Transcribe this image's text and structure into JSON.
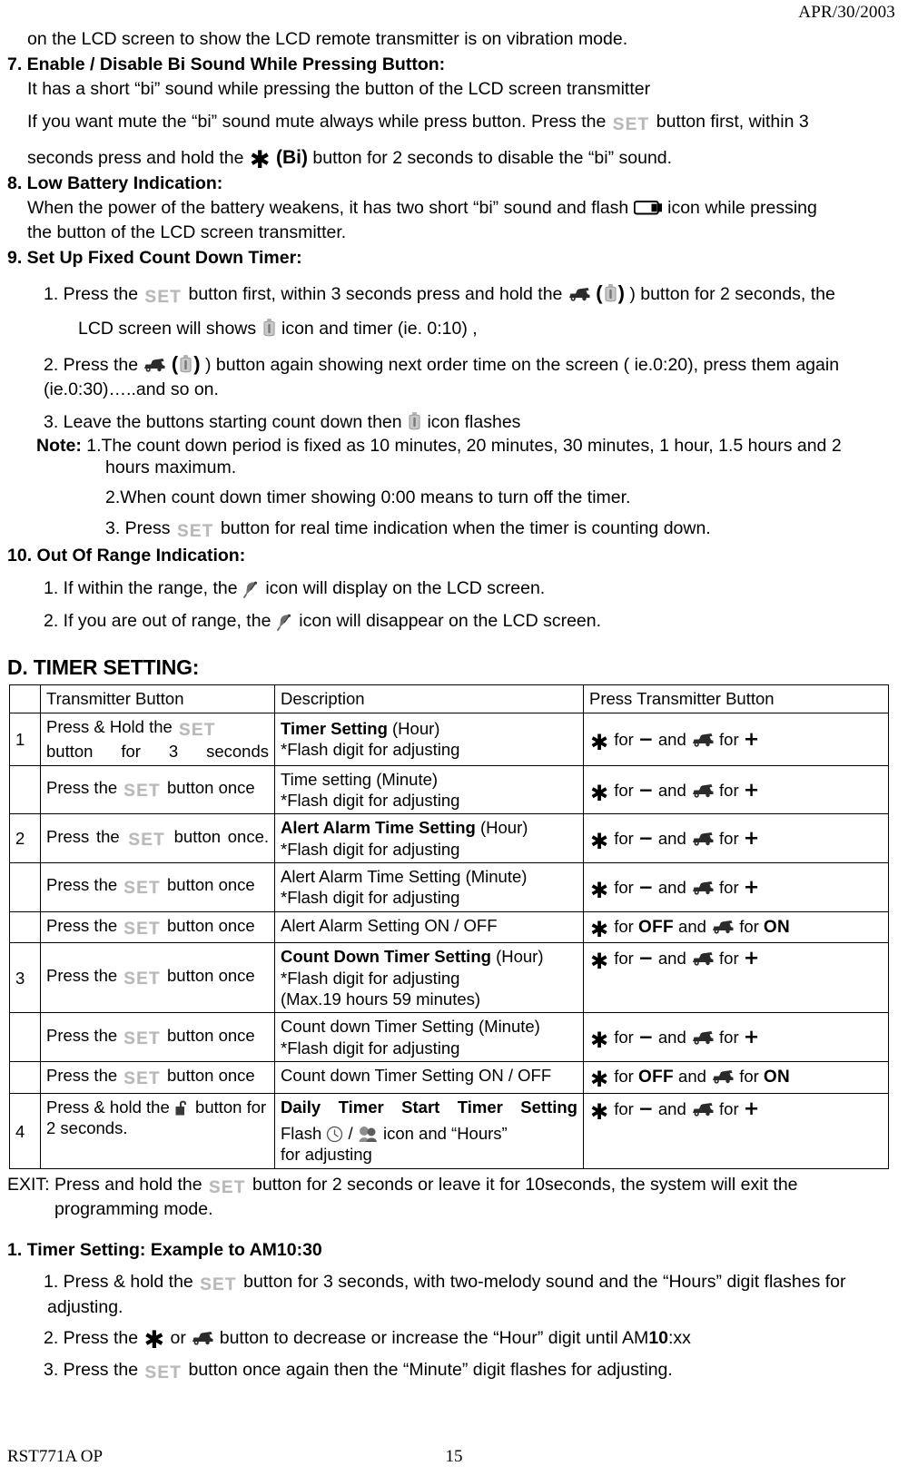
{
  "header": {
    "date": "APR/30/2003"
  },
  "content": {
    "vibration_line": "on the LCD screen to show the LCD remote transmitter is on vibration mode.",
    "s7": {
      "heading": "7. Enable / Disable Bi Sound While Pressing Button:",
      "line1": "It has a short “bi” sound while pressing the button of the LCD screen transmitter",
      "line2_a": "If you want mute the “bi” sound mute always while press button. Press the",
      "line2_b": "button first, within 3",
      "line3_a": "seconds press and hold the",
      "line3_bi": "(Bi)",
      "line3_b": "button for 2 seconds to disable the “bi” sound."
    },
    "s8": {
      "heading": "8. Low Battery Indication:",
      "line1_a": "When the power of the battery weakens, it has two short “bi” sound and flash",
      "line1_b": "icon while pressing",
      "line2": "the button of the LCD screen transmitter."
    },
    "s9": {
      "heading": "9. Set Up Fixed Count Down Timer:",
      "item1_a": "1. Press the",
      "item1_b": "button first, within 3 seconds press and hold the",
      "item1_c": "(",
      "item1_d": ") button for 2 seconds, the",
      "item1_e": "LCD screen will shows",
      "item1_f": "icon and timer (ie. 0:10) ,",
      "item2_a": "2. Press the",
      "item2_b": "(",
      "item2_c": ") button again showing next order time on the screen ( ie.0:20), press them again",
      "item2_d": "(ie.0:30)…..and so on.",
      "item3_a": "3. Leave the buttons starting count down then",
      "item3_b": "icon flashes",
      "note_label": "Note:",
      "note1": "1.The count down period is fixed as 10 minutes, 20 minutes, 30 minutes, 1 hour, 1.5 hours and 2",
      "note1_cont": "hours maximum.",
      "note2": "2.When count down timer showing 0:00 means to turn off the timer.",
      "note3_a": "3. Press",
      "note3_b": "button for real time indication when the timer is counting down."
    },
    "s10": {
      "heading": "10. Out Of Range Indication:",
      "item1_a": "1. If within the range, the",
      "item1_b": "icon will display on the LCD screen.",
      "item2_a": "2. If you are out of range, the",
      "item2_b": "icon will disappear on the LCD screen."
    },
    "section_d": {
      "title": "D. TIMER SETTING:"
    },
    "exit": {
      "line1_a": "EXIT: Press and hold the",
      "line1_b": "button for 2 seconds or leave it for 10seconds, the system will exit the",
      "line2": "programming mode."
    },
    "example": {
      "heading": "1. Timer Setting: Example to AM10:30",
      "step1_a": "1. Press & hold the",
      "step1_b": "button for 3 seconds, with two-melody sound and the “Hours” digit flashes for",
      "step1_c": "adjusting.",
      "step2_a": "2. Press the",
      "step2_or": "or",
      "step2_b": "button to decrease or increase the “Hour” digit until AM",
      "step2_bold": "10",
      "step2_c": ":xx",
      "step3_a": "3. Press the",
      "step3_b": "button once again then the “Minute” digit flashes for adjusting."
    }
  },
  "table": {
    "headers": {
      "num": "",
      "transmitter_button": "Transmitter Button",
      "description": "Description",
      "press_transmitter_button": "Press Transmitter Button"
    },
    "rows": [
      {
        "num": "1",
        "btn_pre": "Press & Hold the",
        "btn_post": "button for 3 seconds",
        "desc_bold": "Timer Setting",
        "desc_plain": " (Hour)",
        "desc_line2": "*Flash digit for adjusting",
        "desc_line3": "",
        "press_type": "plusminus",
        "press_for1": "for",
        "press_minus": "−",
        "press_and": "and",
        "press_for2": "for",
        "press_plus": "+"
      },
      {
        "num": "",
        "btn_pre": "Press the",
        "btn_post": "button once",
        "desc_bold": "",
        "desc_plain": "Time setting (Minute)",
        "desc_line2": "*Flash digit for adjusting",
        "desc_line3": "",
        "press_type": "plusminus",
        "press_for1": "for",
        "press_minus": "−",
        "press_and": "and",
        "press_for2": "for",
        "press_plus": "+"
      },
      {
        "num": "2",
        "btn_pre": "Press the",
        "btn_post": "button once.",
        "desc_bold": "Alert Alarm Time Setting",
        "desc_plain": " (Hour)",
        "desc_line2": "*Flash digit for adjusting",
        "desc_line3": "",
        "press_type": "plusminus",
        "press_for1": "for",
        "press_minus": "−",
        "press_and": "and",
        "press_for2": "for",
        "press_plus": "+"
      },
      {
        "num": "",
        "btn_pre": "Press the",
        "btn_post": "button once",
        "desc_bold": "",
        "desc_plain": "Alert Alarm Time Setting (Minute)",
        "desc_line2": "*Flash digit for adjusting",
        "desc_line3": "",
        "press_type": "plusminus",
        "press_for1": "for",
        "press_minus": "−",
        "press_and": "and",
        "press_for2": "for",
        "press_plus": "+"
      },
      {
        "num": "",
        "btn_pre": "Press the",
        "btn_post": "button once",
        "desc_bold": "",
        "desc_plain": "Alert Alarm Setting ON / OFF",
        "desc_line2": "",
        "desc_line3": "",
        "press_type": "onoff",
        "press_for1": "for",
        "press_off": "OFF",
        "press_and": "and",
        "press_for2": "for",
        "press_on": "ON"
      },
      {
        "num": "3",
        "btn_pre": "Press the",
        "btn_post": "button once",
        "desc_bold": "Count Down Timer Setting",
        "desc_plain": " (Hour)",
        "desc_line2": "*Flash digit for adjusting",
        "desc_line3": "(Max.19 hours 59 minutes)",
        "press_type": "plusminus",
        "press_for1": "for",
        "press_minus": "−",
        "press_and": "and",
        "press_for2": "for",
        "press_plus": "+"
      },
      {
        "num": "",
        "btn_pre": "Press the",
        "btn_post": "button once",
        "desc_bold": "",
        "desc_plain": "Count down Timer Setting (Minute)",
        "desc_line2": "*Flash digit for adjusting",
        "desc_line3": "",
        "press_type": "plusminus",
        "press_for1": "for",
        "press_minus": "−",
        "press_and": "and",
        "press_for2": "for",
        "press_plus": "+"
      },
      {
        "num": "",
        "btn_pre": "Press the",
        "btn_post": "button once",
        "desc_bold": "",
        "desc_plain": "Count down Timer Setting ON / OFF",
        "desc_line2": "",
        "desc_line3": "",
        "press_type": "onoff",
        "press_for1": "for",
        "press_off": "OFF",
        "press_and": "and",
        "press_for2": "for",
        "press_on": "ON"
      },
      {
        "num": "4",
        "btn_pre": "Press & hold the",
        "btn_post": "button for 2 seconds.",
        "btn_icon": "unlock-icon",
        "desc_bold": "Daily Timer Start Timer Setting",
        "desc_plain": "",
        "desc_flash": "Flash",
        "desc_slash": "/",
        "desc_tail": "icon and “Hours”",
        "desc_tail2": "for adjusting",
        "press_type": "plusminus",
        "press_for1": "for",
        "press_minus": "−",
        "press_and": "and",
        "press_for2": "for",
        "press_plus": "+"
      }
    ]
  },
  "footer": {
    "left": "RST771A OP",
    "page_number": "15"
  }
}
